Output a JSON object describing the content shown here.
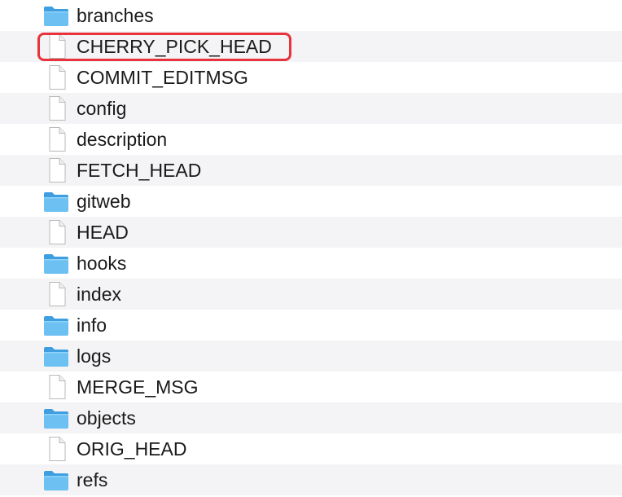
{
  "files": [
    {
      "name": "branches",
      "type": "folder"
    },
    {
      "name": "CHERRY_PICK_HEAD",
      "type": "file"
    },
    {
      "name": "COMMIT_EDITMSG",
      "type": "file"
    },
    {
      "name": "config",
      "type": "file"
    },
    {
      "name": "description",
      "type": "file"
    },
    {
      "name": "FETCH_HEAD",
      "type": "file"
    },
    {
      "name": "gitweb",
      "type": "folder"
    },
    {
      "name": "HEAD",
      "type": "file"
    },
    {
      "name": "hooks",
      "type": "folder"
    },
    {
      "name": "index",
      "type": "file"
    },
    {
      "name": "info",
      "type": "folder"
    },
    {
      "name": "logs",
      "type": "folder"
    },
    {
      "name": "MERGE_MSG",
      "type": "file"
    },
    {
      "name": "objects",
      "type": "folder"
    },
    {
      "name": "ORIG_HEAD",
      "type": "file"
    },
    {
      "name": "refs",
      "type": "folder"
    }
  ],
  "highlighted_item": "CHERRY_PICK_HEAD",
  "colors": {
    "highlight_border": "#e8323c",
    "folder_blue": "#5ab4ec",
    "alt_row": "#f4f4f6"
  }
}
